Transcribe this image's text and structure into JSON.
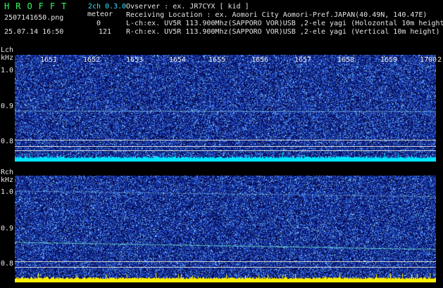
{
  "header": {
    "app_name": "HROFFT",
    "version": "2ch 0.3.0",
    "filename": "2507141650.png",
    "datetime": "25.07.14 16:50",
    "meteor_label": "meteor",
    "lch_count": "0",
    "rch_count": "121",
    "observer_line": "Ovserver            : ex. JR7CYX [ kid ]",
    "location_line": "Receiving Location : ex. Aomori City Aomori-Pref.JAPAN(40.49N, 140.47E)",
    "lch_line": "L-ch:ex. UV5R 113.900Mhz(SAPPORO VOR)USB ,2-ele yagi (Holozontal 10m height)",
    "rch_line": "R-ch:ex. UV5R 113.900Mhz(SAPPORO VOR)USB ,2-ele yagi (Vertical 10m height)"
  },
  "lch": {
    "label": "Lch",
    "unit": "kHz",
    "yticks": [
      "1.0",
      "0.9",
      "0.8"
    ]
  },
  "rch": {
    "label": "Rch",
    "unit": "kHz",
    "yticks": [
      "1.0",
      "0.9",
      "0.8"
    ]
  },
  "time_ticks": [
    "1651",
    "1652",
    "1653",
    "1654",
    "1655",
    "1656",
    "1657",
    "1658",
    "1659",
    "1700",
    "2"
  ],
  "colors": {
    "background": "#000000",
    "noise_base": "#0a1f8c",
    "lch_floor": "#00e5ff",
    "rch_floor": "#ffff00",
    "grid": "#cfcfcf"
  }
}
